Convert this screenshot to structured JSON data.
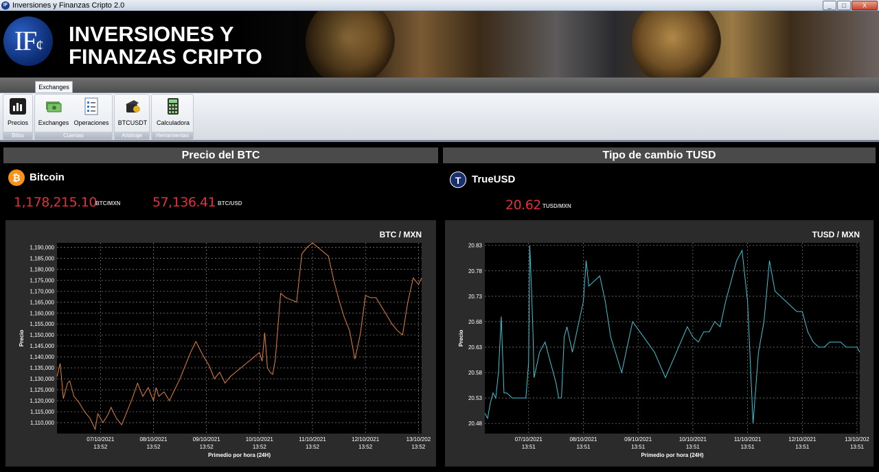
{
  "window": {
    "title": "Inversiones y Finanzas Cripto 2.0",
    "min": "_",
    "max": "□",
    "close": "X"
  },
  "banner": {
    "title": "INVERSIONES Y FINANZAS CRIPTO",
    "logo_text": "IF",
    "logo_sub": "¢"
  },
  "ribbon": {
    "tab": "Exchanges",
    "groups": [
      {
        "label": "Bitso",
        "buttons": [
          {
            "label": "Precios",
            "icon": "chart-icon"
          }
        ]
      },
      {
        "label": "Cuentas",
        "buttons": [
          {
            "label": "Exchanges",
            "icon": "money-icon"
          },
          {
            "label": "Operaciones",
            "icon": "checklist-icon"
          }
        ]
      },
      {
        "label": "Arbitraje",
        "buttons": [
          {
            "label": "BTCUSDT",
            "icon": "wallet-icon"
          }
        ]
      },
      {
        "label": "Herramientas",
        "buttons": [
          {
            "label": "Calculadora",
            "icon": "calculator-icon"
          }
        ]
      }
    ]
  },
  "btc_panel": {
    "header": "Precio del BTC",
    "coin_name": "Bitcoin",
    "icon_glyph": "₿",
    "price_mxn": "1,178,215.10",
    "unit_mxn": "BTC/MXN",
    "price_usd": "57,136.41",
    "unit_usd": "BTC/USD"
  },
  "tusd_panel": {
    "header": "Tipo de cambio TUSD",
    "coin_name": "TrueUSD",
    "icon_glyph": "T",
    "price_mxn": "20.62",
    "unit_mxn": "TUSD/MXN"
  },
  "colors": {
    "btc_line": "#e8823a",
    "tusd_line": "#3fc6d6",
    "price": "#e0313f",
    "btc_icon": "#f7931a",
    "tusd_icon": "#1a2f6e"
  },
  "chart_data": [
    {
      "type": "line",
      "title": "BTC / MXN",
      "ylabel": "Precio",
      "xlabel": "Primedio por hora (24H)",
      "ylim": [
        1105000,
        1192000
      ],
      "yticks": [
        1110000,
        1115000,
        1120000,
        1125000,
        1130000,
        1135000,
        1140000,
        1145000,
        1150000,
        1155000,
        1160000,
        1165000,
        1170000,
        1175000,
        1180000,
        1185000,
        1190000
      ],
      "ytick_labels": [
        "1,110,000",
        "1,115,000",
        "1,120,000",
        "1,125,000",
        "1,130,000",
        "1,135,000",
        "1,140,000",
        "1,145,000",
        "1,150,000",
        "1,155,000",
        "1,160,000",
        "1,165,000",
        "1,170,000",
        "1,175,000",
        "1,180,000",
        "1,185,000",
        "1,190,000"
      ],
      "xlim": [
        -0.82,
        6.06
      ],
      "xticks": [
        0,
        1,
        2,
        3,
        4,
        5,
        6
      ],
      "xtick_labels": [
        [
          "07/10/2021",
          "13:52"
        ],
        [
          "08/10/2021",
          "13:52"
        ],
        [
          "09/10/2021",
          "13:52"
        ],
        [
          "10/10/2021",
          "13:52"
        ],
        [
          "11/10/2021",
          "13:52"
        ],
        [
          "12/10/2021",
          "13:52"
        ],
        [
          "13/10/202",
          "13:52"
        ]
      ],
      "grid": true,
      "series": [
        {
          "color": "#e8823a",
          "x": [
            -0.82,
            -0.76,
            -0.7,
            -0.62,
            -0.58,
            -0.5,
            -0.4,
            -0.3,
            -0.2,
            -0.1,
            -0.05,
            0.0,
            0.05,
            0.1,
            0.15,
            0.2,
            0.3,
            0.4,
            0.5,
            0.6,
            0.7,
            0.8,
            0.9,
            1.0,
            1.05,
            1.1,
            1.2,
            1.3,
            1.4,
            1.5,
            1.6,
            1.7,
            1.8,
            1.95,
            2.05,
            2.15,
            2.25,
            2.35,
            2.45,
            2.55,
            2.6,
            2.7,
            2.8,
            2.9,
            3.0,
            3.05,
            3.1,
            3.15,
            3.2,
            3.25,
            3.3,
            3.35,
            3.4,
            3.5,
            3.6,
            3.7,
            3.8,
            3.9,
            4.0,
            4.05,
            4.1,
            4.2,
            4.3,
            4.4,
            4.5,
            4.6,
            4.7,
            4.8,
            4.9,
            5.0,
            5.1,
            5.2,
            5.3,
            5.4,
            5.5,
            5.6,
            5.7,
            5.8,
            5.9,
            6.0,
            6.06
          ],
          "y": [
            1131000,
            1137000,
            1121000,
            1128000,
            1129000,
            1122000,
            1119000,
            1115000,
            1112000,
            1107000,
            1114000,
            1112000,
            1110000,
            1112000,
            1114000,
            1117000,
            1112000,
            1109000,
            1115000,
            1121000,
            1128000,
            1122000,
            1126000,
            1120000,
            1126000,
            1122000,
            1124000,
            1120000,
            1125000,
            1130000,
            1136000,
            1142000,
            1147000,
            1140000,
            1136000,
            1130000,
            1133000,
            1128000,
            1131000,
            1133000,
            1134000,
            1136000,
            1138000,
            1140000,
            1142000,
            1138000,
            1151000,
            1135000,
            1133000,
            1132000,
            1139000,
            1154000,
            1169000,
            1167000,
            1166000,
            1165000,
            1187000,
            1190000,
            1192000,
            1191000,
            1190000,
            1188000,
            1186000,
            1175000,
            1166000,
            1158000,
            1152000,
            1139000,
            1150000,
            1168000,
            1167000,
            1167000,
            1163000,
            1159000,
            1155000,
            1152000,
            1150000,
            1165000,
            1176000,
            1173000,
            1176000
          ]
        }
      ]
    },
    {
      "type": "line",
      "title": "TUSD / MXN",
      "ylabel": "Precio",
      "xlabel": "Primedio por hora (24H)",
      "ylim": [
        20.46,
        20.835
      ],
      "yticks": [
        20.48,
        20.53,
        20.58,
        20.63,
        20.68,
        20.73,
        20.78,
        20.83
      ],
      "ytick_labels": [
        "20.48",
        "20.53",
        "20.58",
        "20.63",
        "20.68",
        "20.73",
        "20.78",
        "20.83"
      ],
      "xlim": [
        -0.8,
        6.05
      ],
      "xticks": [
        0,
        1,
        2,
        3,
        4,
        5,
        6
      ],
      "xtick_labels": [
        [
          "07/10/2021",
          "13:51"
        ],
        [
          "08/10/2021",
          "13:51"
        ],
        [
          "09/10/2021",
          "13:51"
        ],
        [
          "10/10/2021",
          "13:51"
        ],
        [
          "11/10/2021",
          "13:51"
        ],
        [
          "12/10/2021",
          "13:51"
        ],
        [
          "13/10/202",
          "13:51"
        ]
      ],
      "grid": true,
      "series": [
        {
          "color": "#3fc6d6",
          "x": [
            -0.8,
            -0.75,
            -0.7,
            -0.65,
            -0.6,
            -0.55,
            -0.5,
            -0.45,
            -0.4,
            -0.3,
            -0.2,
            -0.05,
            0.0,
            0.02,
            0.05,
            0.08,
            0.1,
            0.2,
            0.3,
            0.4,
            0.5,
            0.55,
            0.6,
            0.65,
            0.7,
            0.8,
            0.9,
            1.0,
            1.05,
            1.1,
            1.2,
            1.3,
            1.4,
            1.5,
            1.7,
            1.9,
            2.1,
            2.3,
            2.5,
            2.7,
            2.9,
            3.0,
            3.1,
            3.2,
            3.3,
            3.4,
            3.5,
            3.6,
            3.7,
            3.8,
            3.9,
            4.0,
            4.05,
            4.1,
            4.2,
            4.3,
            4.4,
            4.5,
            4.6,
            4.7,
            4.8,
            4.9,
            5.0,
            5.1,
            5.2,
            5.3,
            5.4,
            5.5,
            5.6,
            5.7,
            5.8,
            5.9,
            6.0,
            6.05
          ],
          "y": [
            20.5,
            20.49,
            20.52,
            20.54,
            20.53,
            20.58,
            20.69,
            20.54,
            20.54,
            20.53,
            20.53,
            20.53,
            20.6,
            20.83,
            20.75,
            20.66,
            20.57,
            20.62,
            20.64,
            20.6,
            20.56,
            20.53,
            20.53,
            20.65,
            20.67,
            20.62,
            20.67,
            20.72,
            20.8,
            20.75,
            20.76,
            20.77,
            20.72,
            20.65,
            20.58,
            20.68,
            20.65,
            20.62,
            20.57,
            20.62,
            20.67,
            20.65,
            20.64,
            20.66,
            20.66,
            20.68,
            20.67,
            20.72,
            20.76,
            20.8,
            20.82,
            20.72,
            20.6,
            20.48,
            20.62,
            20.68,
            20.8,
            20.74,
            20.73,
            20.72,
            20.71,
            20.7,
            20.7,
            20.66,
            20.64,
            20.63,
            20.63,
            20.64,
            20.64,
            20.64,
            20.63,
            20.63,
            20.63,
            20.62
          ]
        }
      ]
    }
  ]
}
